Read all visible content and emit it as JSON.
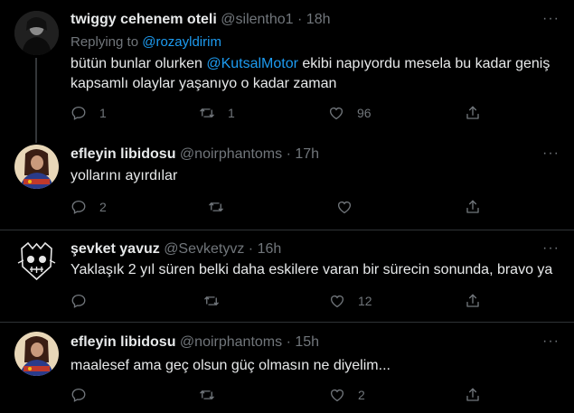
{
  "tweets": [
    {
      "name": "twiggy cehenem oteli",
      "handle": "@silentho1",
      "sep": "·",
      "time": "18h",
      "reply_prefix": "Replying to",
      "reply_to": "@rozayldirim",
      "text_before": "bütün bunlar olurken",
      "mention": "@KutsalMotor",
      "text_after": "ekibi napıyordu mesela bu kadar geniş kapsamlı olaylar yaşanıyo o kadar zaman",
      "replies": "1",
      "retweets": "1",
      "likes": "96"
    },
    {
      "name": "efleyin libidosu",
      "handle": "@noirphantoms",
      "sep": "·",
      "time": "17h",
      "text": "yollarını ayırdılar",
      "replies": "2",
      "retweets": "",
      "likes": ""
    },
    {
      "name": "şevket yavuz",
      "handle": "@Sevketyvz",
      "sep": "·",
      "time": "16h",
      "text": "Yaklaşık 2 yıl süren belki daha eskilere varan bir sürecin sonunda, bravo ya",
      "replies": "",
      "retweets": "",
      "likes": "12"
    },
    {
      "name": "efleyin libidosu",
      "handle": "@noirphantoms",
      "sep": "·",
      "time": "15h",
      "text": "maalesef ama geç olsun güç olmasın ne diyelim...",
      "replies": "",
      "retweets": "",
      "likes": "2"
    }
  ],
  "more_glyph": "···",
  "colors": {
    "background": "#000000",
    "text": "#e7e9ea",
    "muted": "#71767b",
    "accent": "#1d9bf0"
  },
  "icons": [
    "reply-icon",
    "retweet-icon",
    "like-icon",
    "share-icon",
    "more-icon"
  ]
}
